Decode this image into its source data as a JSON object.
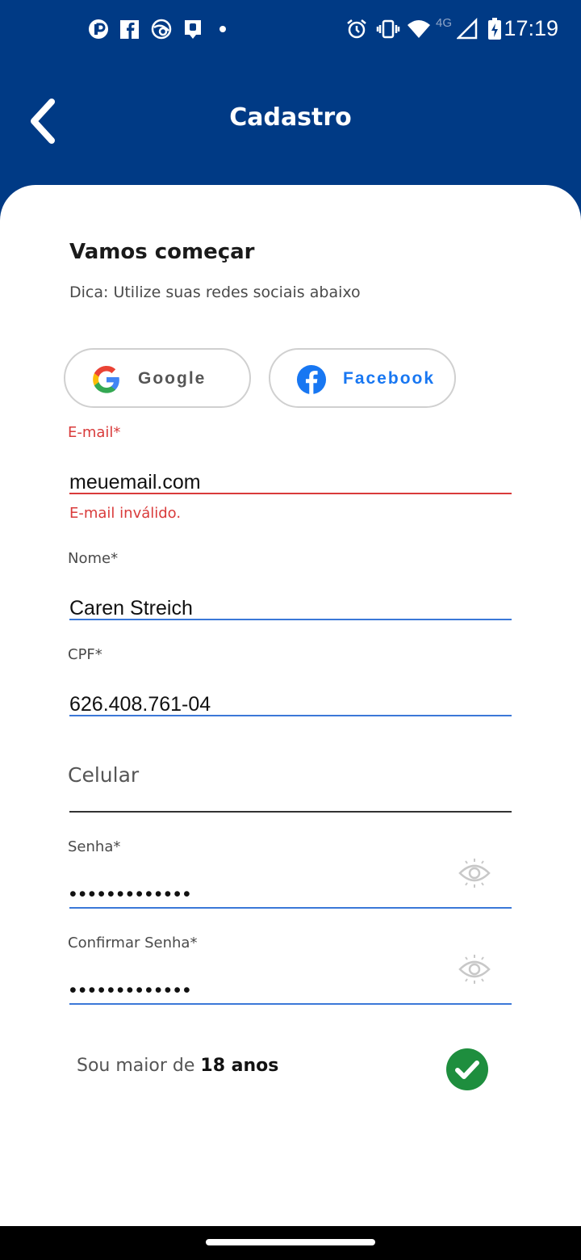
{
  "status_bar": {
    "time": "17:19",
    "network_label": "4G",
    "icons": [
      "notification-app-icon",
      "facebook-icon",
      "browser-icon",
      "alert-icon",
      "dot-icon",
      "alarm-icon",
      "vibrate-icon",
      "wifi-icon",
      "signal-icon",
      "battery-charging-icon"
    ]
  },
  "header": {
    "title": "Cadastro",
    "back_icon": "chevron-left-icon"
  },
  "intro": {
    "heading": "Vamos começar",
    "hint": "Dica: Utilize suas redes sociais abaixo"
  },
  "social": {
    "google_label": "Google",
    "facebook_label": "Facebook"
  },
  "form": {
    "email": {
      "label": "E-mail*",
      "value": "meuemail.com",
      "error": "E-mail inválido."
    },
    "name": {
      "label": "Nome*",
      "value": "Caren Streich"
    },
    "cpf": {
      "label": "CPF*",
      "value": "626.408.761-04"
    },
    "phone": {
      "placeholder": "Celular"
    },
    "password": {
      "label": "Senha*",
      "value": "•••••••••••••"
    },
    "confirm_password": {
      "label": "Confirmar Senha*",
      "value": "•••••••••••••"
    }
  },
  "age_check": {
    "text": "Sou maior de ",
    "emphasis": "18 anos",
    "checked": true
  },
  "colors": {
    "primary": "#003a85",
    "error": "#d93b3b",
    "focus": "#3b78d8",
    "success": "#1e8e3e",
    "facebook": "#1877f2"
  }
}
